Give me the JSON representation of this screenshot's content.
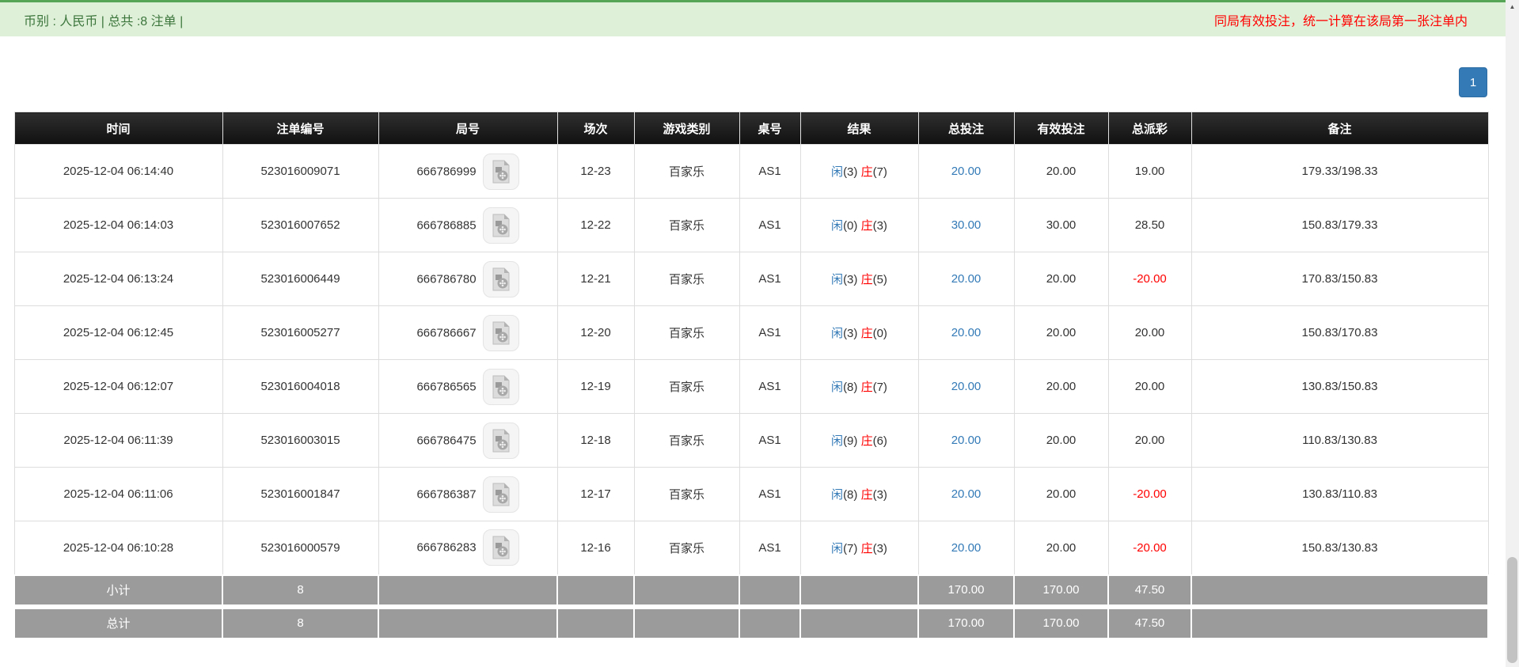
{
  "top_bar": {
    "left_text": "币别 : 人民币 | 总共 :8 注单 |",
    "right_text": "同局有效投注，统一计算在该局第一张注单内"
  },
  "pagination": {
    "current_page": "1"
  },
  "icons": {
    "round_cell": "video-file-icon",
    "scrollbar_top": "triangle-up-icon"
  },
  "colors": {
    "topbar_bg": "#dff0d8",
    "topbar_border_green": "#56a556",
    "notice_red": "#ff0000",
    "pagination_blue": "#337ab7",
    "header_bg": "#1a1a1a",
    "link_blue": "#337ab7",
    "player_blue": "#337ab7",
    "banker_red": "#ff0000",
    "negative_red": "#ff0000",
    "summary_bg": "#9b9b9b"
  },
  "table": {
    "columns": [
      "时间",
      "注单编号",
      "局号",
      "场次",
      "游戏类别",
      "桌号",
      "结果",
      "总投注",
      "有效投注",
      "总派彩",
      "备注"
    ],
    "rows": [
      {
        "time": "2025-12-04 06:14:40",
        "bet_id": "523016009071",
        "round": "666786999",
        "session": "12-23",
        "game_type": "百家乐",
        "table_no": "AS1",
        "result": {
          "player_label": "闲",
          "player_count": "(3)",
          "banker_label": "庄",
          "banker_count": "(7)"
        },
        "total_bet": "20.00",
        "valid_bet": "20.00",
        "total_payout": "19.00",
        "remark": "179.33/198.33"
      },
      {
        "time": "2025-12-04 06:14:03",
        "bet_id": "523016007652",
        "round": "666786885",
        "session": "12-22",
        "game_type": "百家乐",
        "table_no": "AS1",
        "result": {
          "player_label": "闲",
          "player_count": "(0)",
          "banker_label": "庄",
          "banker_count": "(3)"
        },
        "total_bet": "30.00",
        "valid_bet": "30.00",
        "total_payout": "28.50",
        "remark": "150.83/179.33"
      },
      {
        "time": "2025-12-04 06:13:24",
        "bet_id": "523016006449",
        "round": "666786780",
        "session": "12-21",
        "game_type": "百家乐",
        "table_no": "AS1",
        "result": {
          "player_label": "闲",
          "player_count": "(3)",
          "banker_label": "庄",
          "banker_count": "(5)"
        },
        "total_bet": "20.00",
        "valid_bet": "20.00",
        "total_payout": "-20.00",
        "remark": "170.83/150.83"
      },
      {
        "time": "2025-12-04 06:12:45",
        "bet_id": "523016005277",
        "round": "666786667",
        "session": "12-20",
        "game_type": "百家乐",
        "table_no": "AS1",
        "result": {
          "player_label": "闲",
          "player_count": "(3)",
          "banker_label": "庄",
          "banker_count": "(0)"
        },
        "total_bet": "20.00",
        "valid_bet": "20.00",
        "total_payout": "20.00",
        "remark": "150.83/170.83"
      },
      {
        "time": "2025-12-04 06:12:07",
        "bet_id": "523016004018",
        "round": "666786565",
        "session": "12-19",
        "game_type": "百家乐",
        "table_no": "AS1",
        "result": {
          "player_label": "闲",
          "player_count": "(8)",
          "banker_label": "庄",
          "banker_count": "(7)"
        },
        "total_bet": "20.00",
        "valid_bet": "20.00",
        "total_payout": "20.00",
        "remark": "130.83/150.83"
      },
      {
        "time": "2025-12-04 06:11:39",
        "bet_id": "523016003015",
        "round": "666786475",
        "session": "12-18",
        "game_type": "百家乐",
        "table_no": "AS1",
        "result": {
          "player_label": "闲",
          "player_count": "(9)",
          "banker_label": "庄",
          "banker_count": "(6)"
        },
        "total_bet": "20.00",
        "valid_bet": "20.00",
        "total_payout": "20.00",
        "remark": "110.83/130.83"
      },
      {
        "time": "2025-12-04 06:11:06",
        "bet_id": "523016001847",
        "round": "666786387",
        "session": "12-17",
        "game_type": "百家乐",
        "table_no": "AS1",
        "result": {
          "player_label": "闲",
          "player_count": "(8)",
          "banker_label": "庄",
          "banker_count": "(3)"
        },
        "total_bet": "20.00",
        "valid_bet": "20.00",
        "total_payout": "-20.00",
        "remark": "130.83/110.83"
      },
      {
        "time": "2025-12-04 06:10:28",
        "bet_id": "523016000579",
        "round": "666786283",
        "session": "12-16",
        "game_type": "百家乐",
        "table_no": "AS1",
        "result": {
          "player_label": "闲",
          "player_count": "(7)",
          "banker_label": "庄",
          "banker_count": "(3)"
        },
        "total_bet": "20.00",
        "valid_bet": "20.00",
        "total_payout": "-20.00",
        "remark": "150.83/130.83"
      }
    ],
    "subtotal": {
      "label": "小计",
      "count": "8",
      "total_bet": "170.00",
      "valid_bet": "170.00",
      "total_payout": "47.50"
    },
    "total": {
      "label": "总计",
      "count": "8",
      "total_bet": "170.00",
      "valid_bet": "170.00",
      "total_payout": "47.50"
    }
  }
}
